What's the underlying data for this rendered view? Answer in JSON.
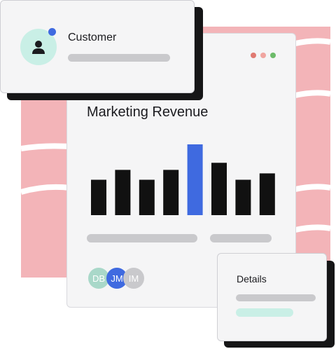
{
  "customer_card": {
    "title": "Customer"
  },
  "chart_card": {
    "title": "Marketing Revenue",
    "window_dots": [
      "#e07a72",
      "#f0a5a0",
      "#6dbb6a"
    ],
    "avatars": [
      {
        "initials": "DB",
        "bg": "#a9d8c9",
        "fg": "#ffffff"
      },
      {
        "initials": "JM",
        "bg": "#3f6ae0",
        "fg": "#ffffff"
      },
      {
        "initials": "IM",
        "bg": "#c9c9cc",
        "fg": "#ffffff"
      }
    ]
  },
  "chart_data": {
    "type": "bar",
    "values": [
      50,
      64,
      50,
      64,
      100,
      74,
      50,
      59
    ],
    "highlight_index": 4,
    "bar_color": "#111111",
    "highlight_color": "#3f6ae0",
    "ylim": [
      0,
      100
    ],
    "grid": false
  },
  "details_card": {
    "title": "Details"
  },
  "colors": {
    "background_pink": "#f3b4b8",
    "accent_blue": "#3f6ae0",
    "mint": "#c9efe6",
    "pill_gray": "#c9c9cc"
  }
}
